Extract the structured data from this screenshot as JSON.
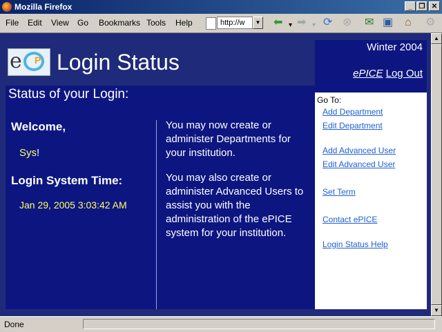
{
  "window": {
    "title": "Mozilla Firefox"
  },
  "menu": [
    "File",
    "Edit",
    "View",
    "Go",
    "Bookmarks",
    "Tools",
    "Help"
  ],
  "address": {
    "value": "http://w"
  },
  "page": {
    "title": "Login Status"
  },
  "header": {
    "term": "Winter 2004",
    "brand": "ePICE",
    "logout": "Log Out"
  },
  "main": {
    "heading": "Status of your Login:",
    "welcome": "Welcome,",
    "username": "Sys",
    "user_suffix": "!",
    "time_label": "Login System Time:",
    "time_value": "Jan 29, 2005 3:03:42 AM",
    "para1": "You may now create or administer Departments for your institution.",
    "para2": "You may also create or administer Advanced Users to assist you with the administration of the ePICE system for your institution."
  },
  "sidebar": {
    "goto": "Go To:",
    "links": [
      "Add Department",
      "Edit Department",
      "Add Advanced User",
      "Edit Advanced User",
      "Set Term",
      "Contact ePICE",
      "Login Status Help"
    ]
  },
  "status": {
    "text": "Done"
  },
  "colors": {
    "page_bg": "#1f2a7a",
    "panel_bg": "#0d1680",
    "link": "#2060d0",
    "highlight": "#ffff66"
  },
  "icons": [
    "firefox-icon",
    "page-icon",
    "back-arrow-icon",
    "forward-arrow-icon",
    "reload-icon",
    "stop-icon",
    "mail-icon",
    "new-window-icon",
    "home-icon"
  ]
}
